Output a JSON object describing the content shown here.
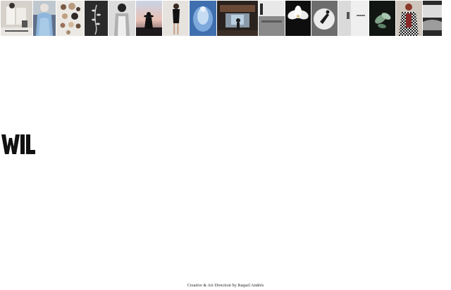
{
  "gallery": {
    "items": [
      {
        "name": "thumb-1",
        "subject": "person-in-white-shirt",
        "caption": ""
      },
      {
        "name": "thumb-2",
        "subject": "person-in-blue-gown"
      },
      {
        "name": "thumb-3",
        "subject": "mushrooms-collage"
      },
      {
        "name": "thumb-4",
        "subject": "dark-botanical"
      },
      {
        "name": "thumb-5",
        "subject": "sculptural-figure"
      },
      {
        "name": "thumb-6",
        "subject": "silhouette-sunset"
      },
      {
        "name": "thumb-7",
        "subject": "woman-in-black-dress"
      },
      {
        "name": "thumb-8",
        "subject": "blue-figure"
      },
      {
        "name": "thumb-9",
        "subject": "train-interior"
      },
      {
        "name": "thumb-10",
        "subject": "landscape-mono"
      },
      {
        "name": "thumb-11",
        "subject": "white-magnolia"
      },
      {
        "name": "thumb-12",
        "subject": "figure-on-circle"
      },
      {
        "name": "thumb-13",
        "subject": "white-room"
      },
      {
        "name": "thumb-14",
        "subject": "green-plant"
      },
      {
        "name": "thumb-15",
        "subject": "woman-in-houndstooth"
      },
      {
        "name": "thumb-16",
        "subject": "mono-landscape-edge"
      }
    ]
  },
  "logo": {
    "text": "WIL",
    "color": "#111111"
  },
  "footer": {
    "credit": "Creative & Art Direction by Raquel Andrés"
  }
}
